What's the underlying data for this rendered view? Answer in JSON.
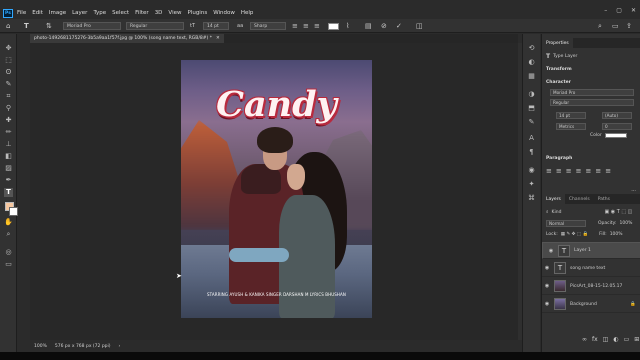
{
  "menubar": {
    "logo": "Ps",
    "items": [
      "File",
      "Edit",
      "Image",
      "Layer",
      "Type",
      "Select",
      "Filter",
      "3D",
      "View",
      "Plugins",
      "Window",
      "Help"
    ]
  },
  "options": {
    "font_family": "Moriad Pro",
    "font_style": "Regular",
    "font_size": "14 pt",
    "antialias": "Sharp",
    "text_color": "#ffffff"
  },
  "document": {
    "tab_label": "photo-1492681175276-3b5a9aa1f57f.jpg @ 100% (song name text, RGB/8#) *",
    "title_text": "Candy",
    "credits_text": "STARRING AYUSH & KANIKA   SINGER DARSHAN M   LYRICS BHUSHAN",
    "status_zoom": "100%",
    "status_size": "576 px x 768 px (72 ppi)"
  },
  "properties": {
    "tab_label": "Properties",
    "layer_kind": "Type Layer",
    "transform_label": "Transform",
    "character_label": "Character",
    "font_family": "Moriad Pro",
    "font_style": "Regular",
    "font_size": "14 pt",
    "leading": "(Auto)",
    "kerning": "Metrics",
    "tracking": "0",
    "color_label": "Color",
    "paragraph_label": "Paragraph"
  },
  "layers_panel": {
    "tabs": [
      "Layers",
      "Channels",
      "Paths"
    ],
    "search_label": "Kind",
    "blend_mode": "Normal",
    "opacity_label": "Opacity:",
    "opacity_value": "100%",
    "lock_label": "Lock:",
    "fill_label": "Fill:",
    "fill_value": "100%",
    "layers": [
      {
        "name": "Layer 1",
        "thumb": "T",
        "selected": true
      },
      {
        "name": "song name text",
        "thumb": "T",
        "selected": false
      },
      {
        "name": "PicsArt_08-15-12.05.17",
        "thumb": "",
        "selected": false
      },
      {
        "name": "Background",
        "thumb": "",
        "selected": false
      }
    ]
  },
  "colors": {
    "foreground": "#f5c7a0",
    "background": "#ffffff",
    "title_stroke": "#b82a3e"
  }
}
